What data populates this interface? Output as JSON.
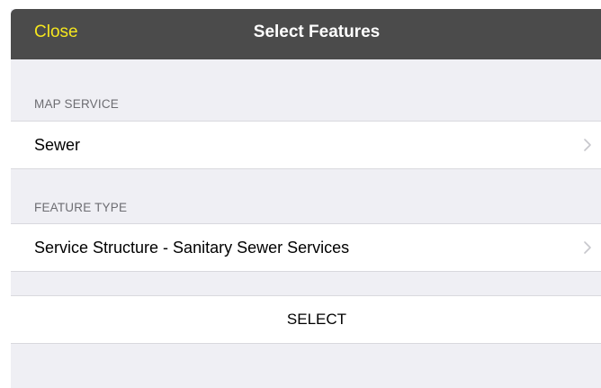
{
  "navbar": {
    "close_label": "Close",
    "title": "Select Features",
    "close_color": "#f5e61e"
  },
  "map_service": {
    "header": "MAP SERVICE",
    "value": "Sewer"
  },
  "feature_type": {
    "header": "FEATURE TYPE",
    "value": "Service Structure - Sanitary Sewer Services"
  },
  "actions": {
    "select_label": "SELECT"
  },
  "icons": {
    "disclosure": "chevron-right-icon"
  }
}
